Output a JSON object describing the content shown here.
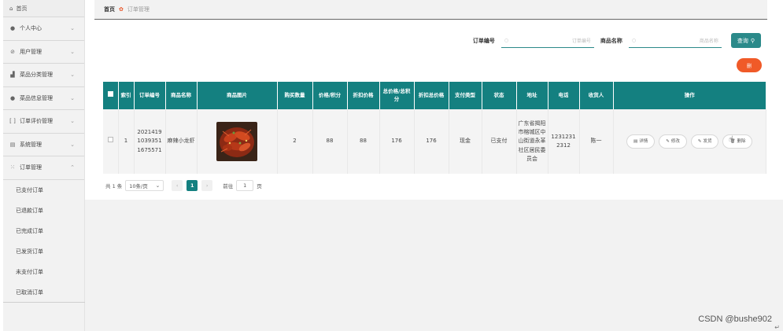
{
  "sidebar": {
    "home": "首页",
    "items": [
      {
        "label": "个人中心",
        "icon": "person-icon"
      },
      {
        "label": "用户管理",
        "icon": "user-manage-icon"
      },
      {
        "label": "菜品分类管理",
        "icon": "chart-icon"
      },
      {
        "label": "菜品信息管理",
        "icon": "person-icon"
      },
      {
        "label": "订单评价管理",
        "icon": "bracket-icon"
      },
      {
        "label": "系统管理",
        "icon": "grid-icon"
      },
      {
        "label": "订单管理",
        "icon": "apps-icon"
      }
    ],
    "submenu": [
      "已支付订单",
      "已退款订单",
      "已完成订单",
      "已发货订单",
      "未支付订单",
      "已取消订单"
    ]
  },
  "breadcrumb": {
    "home": "首页",
    "current": "订单管理"
  },
  "search": {
    "order_no_label": "订单编号",
    "order_no_placeholder": "订单编号",
    "dish_name_label": "商品名称",
    "dish_name_placeholder": "商品名称",
    "query_label": "查询"
  },
  "delete_label": "删",
  "table": {
    "headers": [
      "索引",
      "订单编号",
      "商品名称",
      "商品图片",
      "购买数量",
      "价格/积分",
      "折扣价格",
      "总价格/总积分",
      "折扣总价格",
      "支付类型",
      "状态",
      "地址",
      "电话",
      "收货人",
      "操作"
    ],
    "row": {
      "index": "1",
      "order_no": "2021419 1039351 1675571",
      "dish_name": "麻辣小龙虾",
      "quantity": "2",
      "price": "88",
      "discount_price": "88",
      "total": "176",
      "discount_total": "176",
      "pay_type": "现金",
      "status": "已支付",
      "address": "广东省揭阳市榕城区中山街道永革社区居民委员会",
      "phone": "1231231 2312",
      "receiver": "陈一",
      "actions": {
        "detail": "详情",
        "edit": "修改",
        "ship": "发货",
        "delete": "删除"
      }
    }
  },
  "pager": {
    "total": "共 1 条",
    "page_size": "10条/页",
    "current_page": "1",
    "goto_label": "前往",
    "goto_value": "1",
    "page_unit": "页"
  },
  "watermark": "CSDN @bushe902",
  "colors": {
    "teal": "#148080",
    "orange": "#f05a28"
  }
}
